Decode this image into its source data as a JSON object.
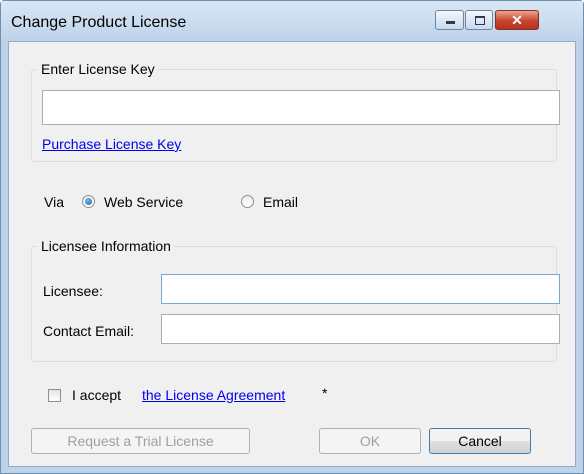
{
  "window": {
    "title": "Change Product License",
    "close_glyph": "✕"
  },
  "license_key": {
    "group_label": "Enter License Key",
    "value": "",
    "purchase_link": "Purchase License Key"
  },
  "via": {
    "label": "Via",
    "options": [
      {
        "label": "Web Service",
        "selected": true
      },
      {
        "label": "Email",
        "selected": false
      }
    ]
  },
  "licensee_info": {
    "group_label": "Licensee Information",
    "licensee_label": "Licensee:",
    "licensee_value": "",
    "email_label": "Contact Email:",
    "email_value": ""
  },
  "agreement": {
    "checked": false,
    "prefix": "I accept",
    "link": "the License Agreement",
    "required_marker": "*"
  },
  "buttons": {
    "trial": "Request a Trial License",
    "ok": "OK",
    "cancel": "Cancel"
  },
  "colors": {
    "titlebar": "#bdd3ea",
    "client_bg": "#f0f0f0",
    "link": "#0000ee",
    "close_button": "#c7442d"
  }
}
